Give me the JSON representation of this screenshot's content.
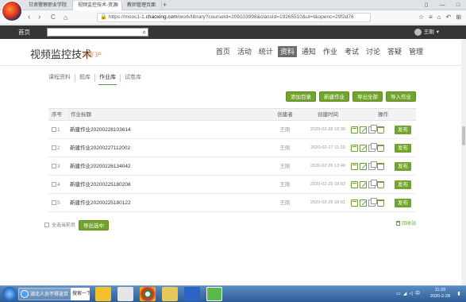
{
  "browser": {
    "tabs": [
      {
        "label": "甘肃警察职业学院",
        "active": false
      },
      {
        "label": "视频监控技术-资源",
        "active": true
      },
      {
        "label": "教师管理页面",
        "active": false
      }
    ],
    "new_tab": "+",
    "url_prefix": "https://mooc1-1.",
    "url_domain": "chaoxing.com",
    "url_rest": "/work/library?courseId=209103998&classId=19265510&ut=t&openc=29f2d76",
    "nav": {
      "back": "‹",
      "forward": "›",
      "reload": "C",
      "home": "⌂"
    },
    "window_controls": [
      "▯",
      "—",
      "□"
    ]
  },
  "site": {
    "home_label": "首页",
    "search_placeholder": "",
    "user_name": "王刚"
  },
  "course": {
    "title": "视频监控技术",
    "portal": "课程门户",
    "nav": [
      {
        "label": "首页",
        "active": false
      },
      {
        "label": "活动",
        "active": false
      },
      {
        "label": "统计",
        "active": false
      },
      {
        "label": "资料",
        "active": true
      },
      {
        "label": "通知",
        "active": false
      },
      {
        "label": "作业",
        "active": false
      },
      {
        "label": "考试",
        "active": false
      },
      {
        "label": "讨论",
        "active": false
      },
      {
        "label": "答疑",
        "active": false
      },
      {
        "label": "管理",
        "active": false
      }
    ]
  },
  "subtabs": [
    {
      "label": "课程资料",
      "active": false
    },
    {
      "label": "题库",
      "active": false
    },
    {
      "label": "作业库",
      "active": true
    },
    {
      "label": "试卷库",
      "active": false
    }
  ],
  "actions": {
    "add_directory": "添加目录",
    "new_homework": "新建作业",
    "export_all": "导出全部",
    "import_homework": "导入作业"
  },
  "table": {
    "headers": {
      "no": "序号",
      "title": "作业标题",
      "creator": "创建者",
      "time": "创建时间",
      "ops": "操作"
    },
    "rows": [
      {
        "no": "1",
        "title": "新建作业20200228103614",
        "creator": "王刚",
        "time": "2020-02-28 10:36",
        "publish": "发布"
      },
      {
        "no": "2",
        "title": "新建作业20200227112002",
        "creator": "王刚",
        "time": "2020-02-27 11:20",
        "publish": "发布"
      },
      {
        "no": "3",
        "title": "新建作业20200226134042",
        "creator": "王刚",
        "time": "2020-02-26 13:40",
        "publish": "发布"
      },
      {
        "no": "4",
        "title": "新建作业20200225180208",
        "creator": "王刚",
        "time": "2020-02-25 18:02",
        "publish": "发布"
      },
      {
        "no": "5",
        "title": "新建作业20200225180122",
        "creator": "王刚",
        "time": "2020-02-25 18:01",
        "publish": "发布"
      }
    ]
  },
  "footer": {
    "select_all": "全选当前页",
    "export_selected": "导出选中",
    "recycle_bin": "回收站"
  },
  "taskbar": {
    "ie_window": "湖北人员不得返京",
    "search": "搜索一下",
    "clock_time": "11:39",
    "clock_date": "2020-2-28",
    "show_desktop": "▮"
  },
  "colors": {
    "accent_green": "#72a42c",
    "site_bar": "#343638",
    "portal_orange": "#e8640c"
  }
}
